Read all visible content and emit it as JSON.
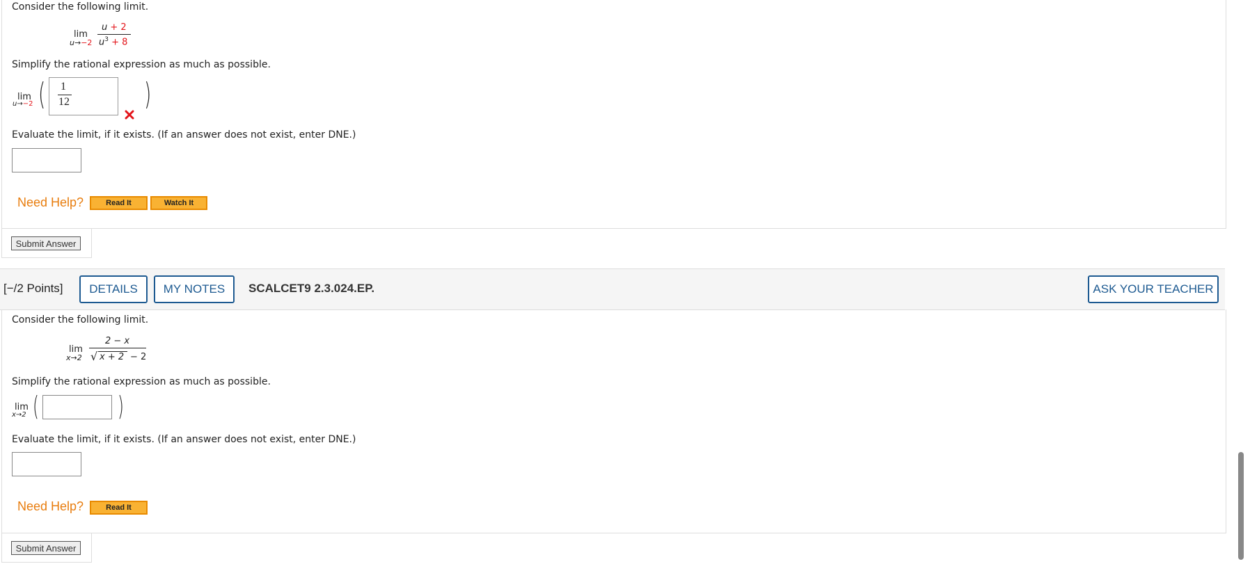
{
  "q1": {
    "intro": "Consider the following limit.",
    "limit": {
      "lim": "lim",
      "sub_var": "u",
      "sub_arrow": "→",
      "sub_target": "−2",
      "num_var": "u",
      "num_rest": "+ 2",
      "den_var": "u",
      "den_exp": "3",
      "den_rest": "+ 8"
    },
    "simplify_prompt": "Simplify the rational expression as much as possible.",
    "answer_lim": {
      "lim": "lim",
      "sub_var": "u",
      "sub_arrow": "→",
      "sub_target": "−2"
    },
    "answer_num": "1",
    "answer_den": "12",
    "evaluate_prompt": "Evaluate the limit, if it exists. (If an answer does not exist, enter DNE.)",
    "evaluate_value": "",
    "need_help": "Need Help?",
    "read_it": "Read It",
    "watch_it": "Watch It",
    "submit": "Submit Answer"
  },
  "q2": {
    "points": "[−/2 Points]",
    "details": "DETAILS",
    "my_notes": "MY NOTES",
    "code": "SCALCET9 2.3.024.EP.",
    "ask_teacher": "ASK YOUR TEACHER",
    "intro": "Consider the following limit.",
    "limit": {
      "lim": "lim",
      "sub": "x→2",
      "num": "2 − x",
      "sqrt_inner": "x + 2",
      "den_rest": "− 2"
    },
    "simplify_prompt": "Simplify the rational expression as much as possible.",
    "answer_lim": {
      "lim": "lim",
      "sub": "x→2"
    },
    "answer_value": "",
    "evaluate_prompt": "Evaluate the limit, if it exists. (If an answer does not exist, enter DNE.)",
    "evaluate_value": "",
    "need_help": "Need Help?",
    "read_it": "Read It",
    "submit": "Submit Answer"
  },
  "colors": {
    "accent": "#1d5a91",
    "help": "#e87d0e",
    "error": "#e3141a",
    "button": "#f9b233"
  }
}
